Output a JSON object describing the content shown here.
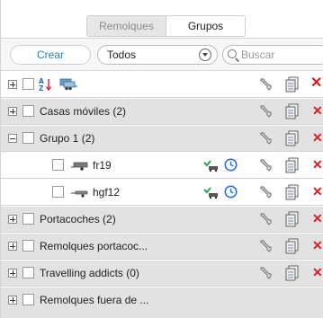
{
  "tabs": {
    "remolques": "Remolques",
    "grupos": "Grupos",
    "active": "grupos"
  },
  "toolbar": {
    "create_label": "Crear",
    "filter_value": "Todos",
    "search_placeholder": "Buscar"
  },
  "header_row": {
    "sort_icon": "sort-az-icon",
    "group_icon": "trailer-group-icon"
  },
  "rows": [
    {
      "label": "Casas móviles (2)",
      "expanded": false,
      "type": "group"
    },
    {
      "label": "Grupo 1 (2)",
      "expanded": true,
      "type": "group"
    },
    {
      "label": "fr19",
      "type": "unit"
    },
    {
      "label": "hgf12",
      "type": "unit"
    },
    {
      "label": "Portacoches (2)",
      "expanded": false,
      "type": "group"
    },
    {
      "label": "Remolques portacoc...",
      "expanded": false,
      "type": "group"
    },
    {
      "label": "Travelling addicts (0)",
      "expanded": false,
      "type": "group"
    },
    {
      "label": "Remolques fuera de ...",
      "expanded": false,
      "type": "group"
    }
  ],
  "colors": {
    "accent": "#2a7fc4",
    "delete": "#e01b1b",
    "clock": "#2b6fd6",
    "key": "#2aa44a"
  }
}
